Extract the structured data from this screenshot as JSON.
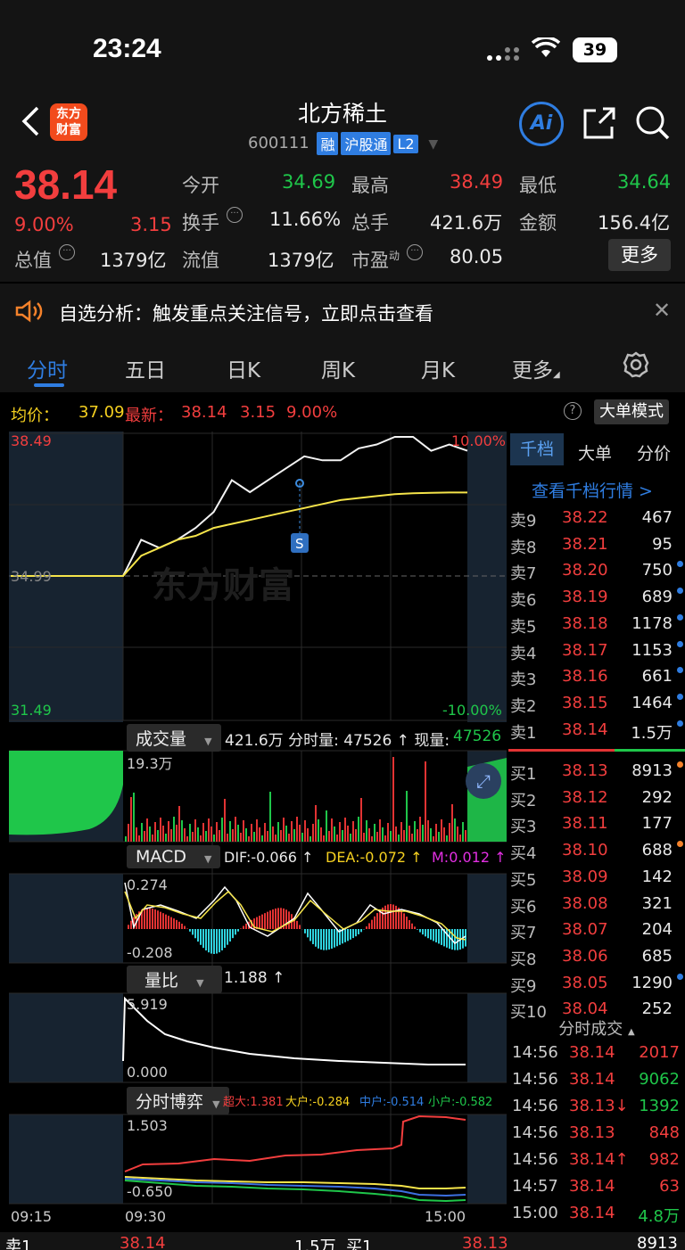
{
  "status": {
    "time": "23:24",
    "battery": "39"
  },
  "header": {
    "logo_line1": "东方",
    "logo_line2": "财富",
    "title": "北方稀土",
    "code": "600111",
    "tags": [
      "融",
      "沪股通",
      "L2"
    ],
    "ai_label": "Ai"
  },
  "quote": {
    "price": "38.14",
    "change_pct": "9.00%",
    "change": "3.15",
    "rows": [
      [
        {
          "l": "今开",
          "v": "34.69",
          "c": "green"
        },
        {
          "l": "最高",
          "v": "38.49",
          "c": "red"
        },
        {
          "l": "最低",
          "v": "34.64",
          "c": "green"
        }
      ],
      [
        {
          "l": "换手",
          "v": "11.66%",
          "c": "white"
        },
        {
          "l": "总手",
          "v": "421.6万",
          "c": "white"
        },
        {
          "l": "金额",
          "v": "156.4亿",
          "c": "white"
        }
      ]
    ],
    "total_value_label": "总值",
    "total_value": "1379亿",
    "float_label": "流值",
    "float_value": "1379亿",
    "pe_label": "市盈",
    "pe_sup": "动",
    "pe_value": "80.05",
    "more_label": "更多"
  },
  "signal": {
    "text": "自选分析：触发重点关注信号，立即点击查看"
  },
  "tabs": [
    "分时",
    "五日",
    "日K",
    "周K",
    "月K",
    "更多"
  ],
  "chart": {
    "avg_label": "均价：",
    "avg_value": "37.09",
    "last_label": "最新：",
    "last_value": "38.14",
    "last_change": "3.15",
    "last_pct": "9.00%",
    "big_order_mode": "大单模式",
    "y_top": "38.49",
    "y_mid": "34.99",
    "y_bottom": "31.49",
    "pct_top": "10.00%",
    "pct_bottom": "-10.00%",
    "watermark": "东方财富",
    "s_marker": "S",
    "x_labels": [
      "09:15",
      "09:30",
      "15:00"
    ]
  },
  "chart_data": {
    "type": "line",
    "title": "",
    "x_labels": [
      "09:15",
      "09:30",
      "15:00"
    ],
    "ylim": [
      31.49,
      38.49
    ],
    "prev_close": 34.99,
    "series": [
      {
        "name": "价",
        "values": [
          34.99,
          34.99,
          35.9,
          35.7,
          35.9,
          36.2,
          36.6,
          37.4,
          37.1,
          37.4,
          37.7,
          38.0,
          37.9,
          37.9,
          38.2,
          38.3,
          38.49,
          38.49,
          38.14,
          38.3,
          38.14
        ]
      },
      {
        "name": "均价",
        "values": [
          34.99,
          34.99,
          35.5,
          35.7,
          35.9,
          36.0,
          36.2,
          36.3,
          36.4,
          36.5,
          36.6,
          36.7,
          36.8,
          36.9,
          36.95,
          37.0,
          37.05,
          37.07,
          37.08,
          37.09,
          37.09
        ]
      }
    ]
  },
  "volume": {
    "label": "成交量",
    "text": "421.6万 分时量: 47526 ↑ 现量:",
    "now": "47526",
    "max": "19.3万"
  },
  "macd": {
    "label": "MACD",
    "dif": "DIF:-0.066 ↑",
    "dea": "DEA:-0.072 ↑",
    "m": "M:0.012 ↑",
    "top": "0.274",
    "bottom": "-0.208"
  },
  "volratio": {
    "label": "量比",
    "value": "1.188 ↑",
    "top": "5.919",
    "bottom": "0.000"
  },
  "game": {
    "label": "分时博弈",
    "super": "超大:1.381",
    "big": "大户:-0.284",
    "mid": "中户:-0.514",
    "small": "小户:-0.582",
    "top": "1.503",
    "bottom": "-0.650"
  },
  "orderbook": {
    "tabs": [
      "千档",
      "大单",
      "分价"
    ],
    "link": "查看千档行情 >",
    "asks": [
      [
        "卖9",
        "38.22",
        "467"
      ],
      [
        "卖8",
        "38.21",
        "95"
      ],
      [
        "卖7",
        "38.20",
        "750"
      ],
      [
        "卖6",
        "38.19",
        "689"
      ],
      [
        "卖5",
        "38.18",
        "1178"
      ],
      [
        "卖4",
        "38.17",
        "1153"
      ],
      [
        "卖3",
        "38.16",
        "661"
      ],
      [
        "卖2",
        "38.15",
        "1464"
      ],
      [
        "卖1",
        "38.14",
        "1.5万"
      ]
    ],
    "bids": [
      [
        "买1",
        "38.13",
        "8913"
      ],
      [
        "买2",
        "38.12",
        "292"
      ],
      [
        "买3",
        "38.11",
        "177"
      ],
      [
        "买4",
        "38.10",
        "688"
      ],
      [
        "买5",
        "38.09",
        "142"
      ],
      [
        "买6",
        "38.08",
        "321"
      ],
      [
        "买7",
        "38.07",
        "204"
      ],
      [
        "买8",
        "38.06",
        "685"
      ],
      [
        "买9",
        "38.05",
        "1290"
      ],
      [
        "买10",
        "38.04",
        "252"
      ]
    ],
    "trades_label": "分时成交",
    "trades": [
      [
        "14:56",
        "38.14",
        "2017"
      ],
      [
        "14:56",
        "38.14",
        "9062"
      ],
      [
        "14:56",
        "38.13↓",
        "1392"
      ],
      [
        "14:56",
        "38.13",
        "848"
      ],
      [
        "14:56",
        "38.14↑",
        "982"
      ],
      [
        "14:57",
        "38.14",
        "63"
      ],
      [
        "15:00",
        "38.14",
        "4.8万"
      ]
    ]
  },
  "bottom": {
    "sell_label": "卖1",
    "sell_price": "38.14",
    "sell_vol": "1.5万",
    "buy_label": "买1",
    "buy_price": "38.13",
    "buy_vol": "8913"
  }
}
